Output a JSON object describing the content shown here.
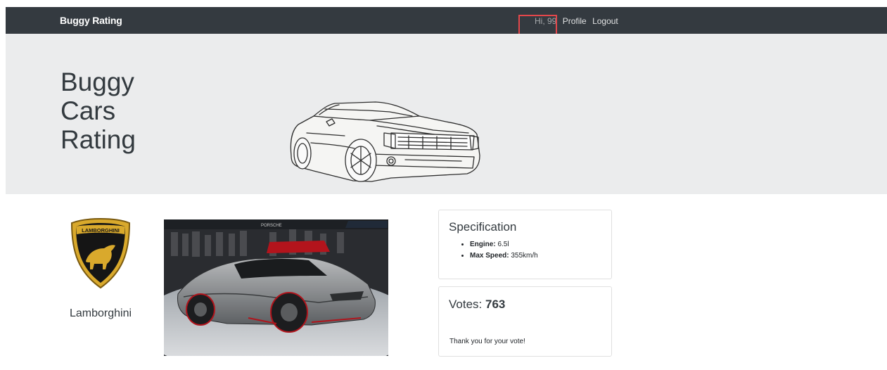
{
  "navbar": {
    "brand": "Buggy Rating",
    "greeting": "Hi, 99",
    "links": [
      "Profile",
      "Logout"
    ]
  },
  "hero": {
    "title_lines": [
      "Buggy",
      "Cars",
      "Rating"
    ],
    "image_icon": "sports-car-sketch-icon"
  },
  "make": {
    "name": "Lamborghini",
    "logo_icon": "lamborghini-shield-logo",
    "logo_text": "LAMBORGHINI"
  },
  "model": {
    "image_icon": "car-photo",
    "photo_text": "PORSCHE"
  },
  "specification": {
    "heading": "Specification",
    "items": [
      {
        "label": "Engine:",
        "value": " 6.5l"
      },
      {
        "label": "Max Speed:",
        "value": " 355km/h"
      }
    ]
  },
  "votes": {
    "label": "Votes: ",
    "count": "763",
    "message": "Thank you for your vote!"
  },
  "colors": {
    "navbar": "#343a40",
    "jumbotron": "#ebeced",
    "highlight": "#e4474b"
  }
}
